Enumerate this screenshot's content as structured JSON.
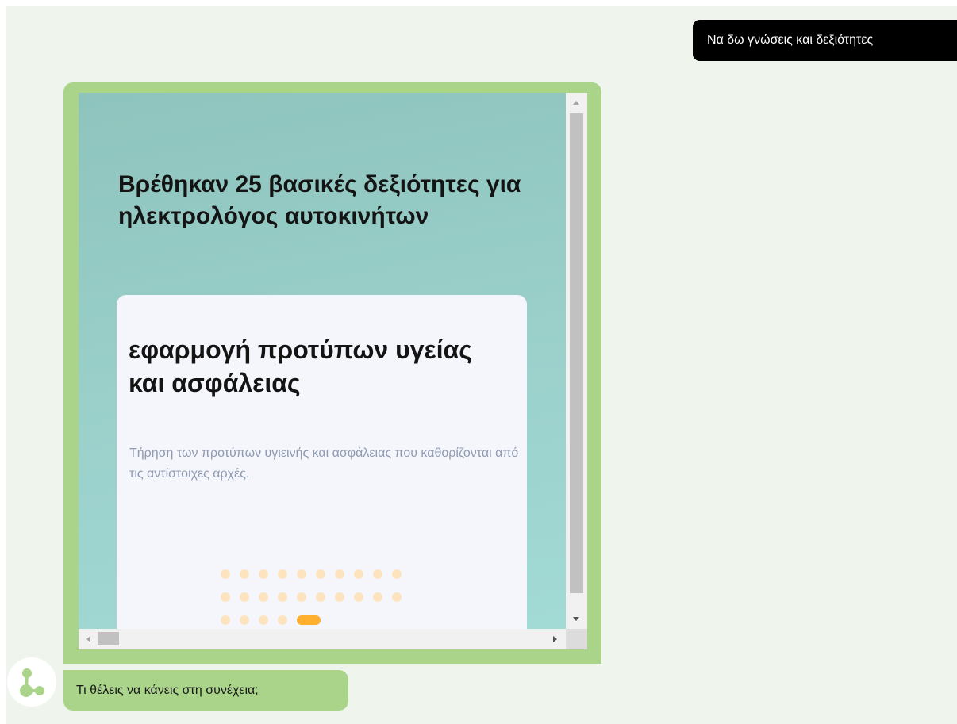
{
  "user_message": "Να δω γνώσεις και δεξιότητες",
  "skills_card": {
    "heading": "Βρέθηκαν 25 βασικές δεξιότητες για ηλεκτρολόγος αυτοκινήτων",
    "current_skill": {
      "title": "εφαρμογή προτύπων υγείας και ασφάλειας",
      "description": "Τήρηση των προτύπων υγιεινής και ασφάλειας που καθορίζονται από τις αντίστοιχες αρχές."
    },
    "pagination": {
      "total": 25,
      "active_index": 24,
      "per_row": 10,
      "inactive_color": "#fde4bf",
      "active_color": "#ffb02e"
    }
  },
  "bot_message": "Τι θέλεις να κάνεις στη συνέχεια;",
  "bot_avatar_icon": "share-nodes-icon",
  "colors": {
    "chat_background": "#eff4ec",
    "user_bubble": "#000000",
    "bot_bubble": "#a9d48a",
    "card_gradient_top": "#8ec4bd",
    "card_gradient_bottom": "#a2dad6",
    "avatar_icon": "#a9d48a"
  }
}
